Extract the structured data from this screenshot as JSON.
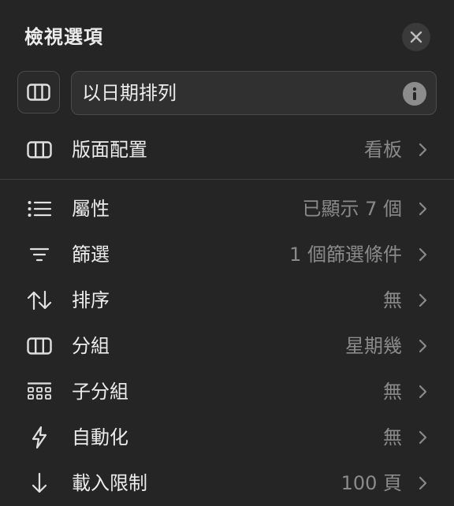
{
  "header": {
    "title": "檢視選項",
    "close_icon": "close-icon"
  },
  "view_name": {
    "layout_icon": "columns-icon",
    "value": "以日期排列",
    "info_icon": "info-icon"
  },
  "layout_row": {
    "icon": "columns-icon",
    "label": "版面配置",
    "value": "看板"
  },
  "options": [
    {
      "icon": "list-icon",
      "label": "屬性",
      "value": "已顯示 7 個"
    },
    {
      "icon": "filter-icon",
      "label": "篩選",
      "value": "1 個篩選條件"
    },
    {
      "icon": "sort-icon",
      "label": "排序",
      "value": "無"
    },
    {
      "icon": "columns-icon",
      "label": "分組",
      "value": "星期幾"
    },
    {
      "icon": "sub-group-icon",
      "label": "子分組",
      "value": "無"
    },
    {
      "icon": "lightning-icon",
      "label": "自動化",
      "value": "無"
    },
    {
      "icon": "arrow-down-icon",
      "label": "載入限制",
      "value": "100 頁"
    }
  ],
  "colors": {
    "background": "#252525",
    "text_primary": "#ececec",
    "text_secondary": "#8a8a8a",
    "border": "#4a4a4a"
  }
}
